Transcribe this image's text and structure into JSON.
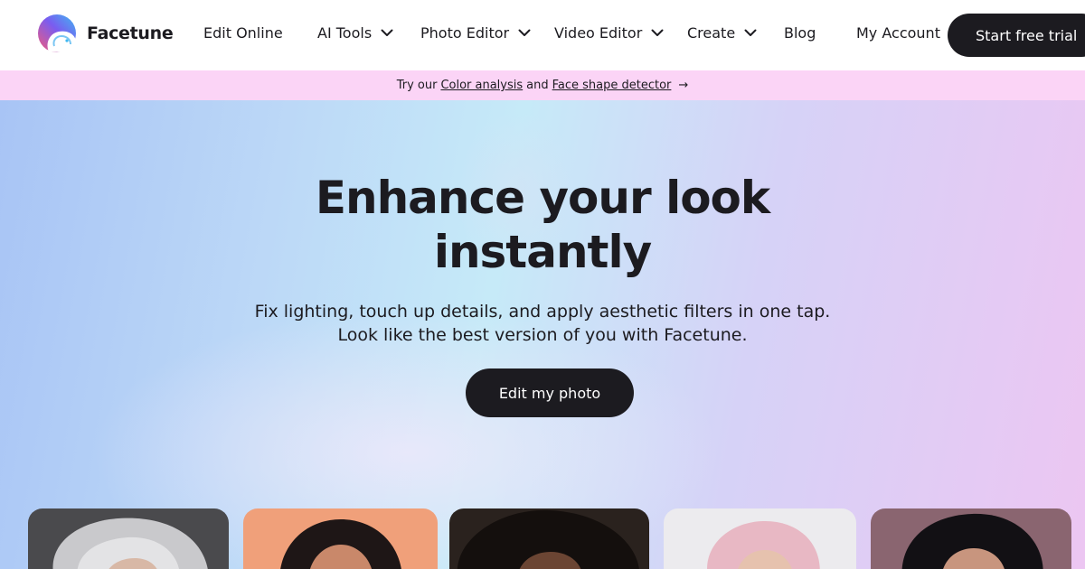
{
  "brand": {
    "name": "Facetune",
    "logo_colors": [
      "#f25a7b",
      "#7a5cf0",
      "#3fb9f2",
      "#ffffff"
    ]
  },
  "nav": {
    "items": [
      {
        "label": "Edit Online",
        "dropdown": false
      },
      {
        "label": "AI Tools",
        "dropdown": true
      },
      {
        "label": "Photo Editor",
        "dropdown": true
      },
      {
        "label": "Video Editor",
        "dropdown": true
      },
      {
        "label": "Create",
        "dropdown": true
      },
      {
        "label": "Blog",
        "dropdown": false
      },
      {
        "label": "My Account",
        "dropdown": false
      }
    ],
    "cta_label": "Start free trial"
  },
  "banner": {
    "prefix": "Try our",
    "link1": "Color analysis",
    "middle": "and",
    "link2": "Face shape detector",
    "arrow": "→",
    "background": "#fbd4f6"
  },
  "hero": {
    "headline_line1": "Enhance your look",
    "headline_line2": "instantly",
    "sub_line1": "Fix lighting, touch up details, and apply aesthetic filters in one tap.",
    "sub_line2": "Look like the best version of you with Facetune.",
    "button_label": "Edit my photo"
  },
  "cards": [
    {
      "subject": "silver-haired-woman-photo"
    },
    {
      "subject": "dark-haired-woman-peach-background-photo"
    },
    {
      "subject": "curly-haired-person-photo"
    },
    {
      "subject": "pink-haired-person-photo"
    },
    {
      "subject": "dark-haired-man-photo"
    }
  ],
  "colors": {
    "ink": "#1c1b20",
    "button_bg": "#1c1b20",
    "button_text": "#ffffff"
  }
}
